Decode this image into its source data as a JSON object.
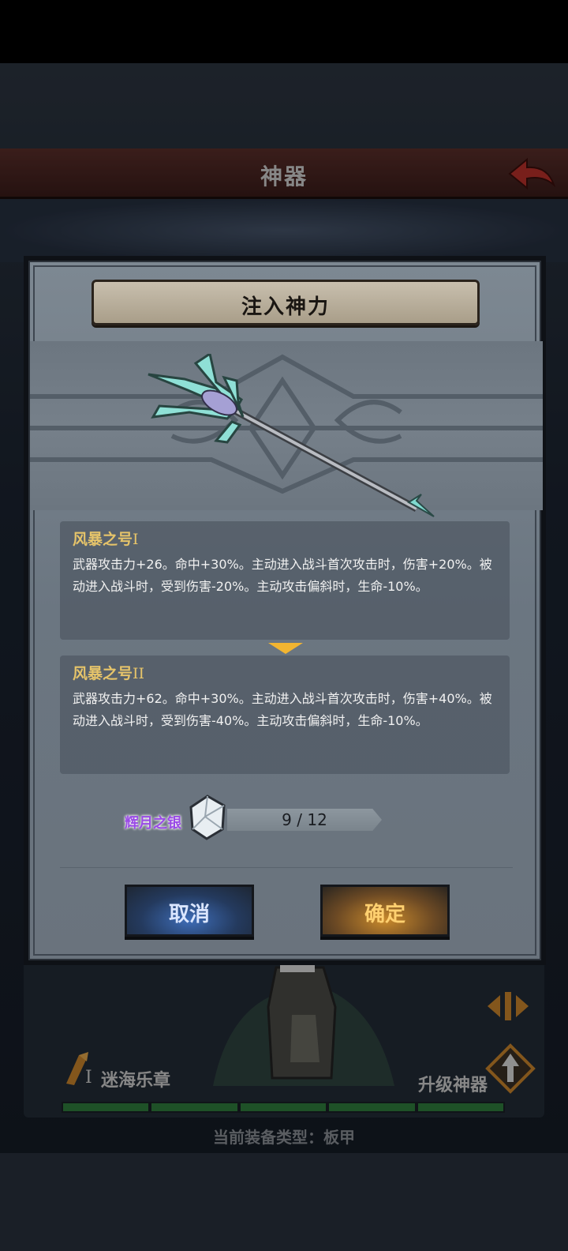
{
  "screen": {
    "title": "神器"
  },
  "modal": {
    "title": "注入神力",
    "current": {
      "name": "风暴之号",
      "level": "I",
      "description": "武器攻击力+26。命中+30%。主动进入战斗首次攻击时，伤害+20%。被动进入战斗时，受到伤害-20%。主动攻击偏斜时，生命-10%。"
    },
    "next": {
      "name": "风暴之号",
      "level": "II",
      "description": "武器攻击力+62。命中+30%。主动进入战斗首次攻击时，伤害+40%。被动进入战斗时，受到伤害-40%。主动攻击偏斜时，生命-10%。"
    },
    "cost": {
      "label": "辉月之银",
      "value": "9 / 12",
      "owned": 9,
      "required": 12
    },
    "cancel_label": "取消",
    "confirm_label": "确定"
  },
  "background": {
    "artifact_name": "迷海乐章",
    "artifact_level": "I",
    "upgrade_label": "升级神器",
    "equip_type": "当前装备类型：板甲"
  },
  "colors": {
    "accent_gold": "#e6c46a",
    "cost_purple": "#9a4be6",
    "cancel_blue": "#3e6db8",
    "confirm_orange": "#c98a2c"
  },
  "icons": [
    "back-arrow-icon",
    "trident-icon",
    "gem-icon",
    "down-arrow-icon",
    "weapon-icon",
    "upgrade-icon",
    "swap-icon"
  ]
}
